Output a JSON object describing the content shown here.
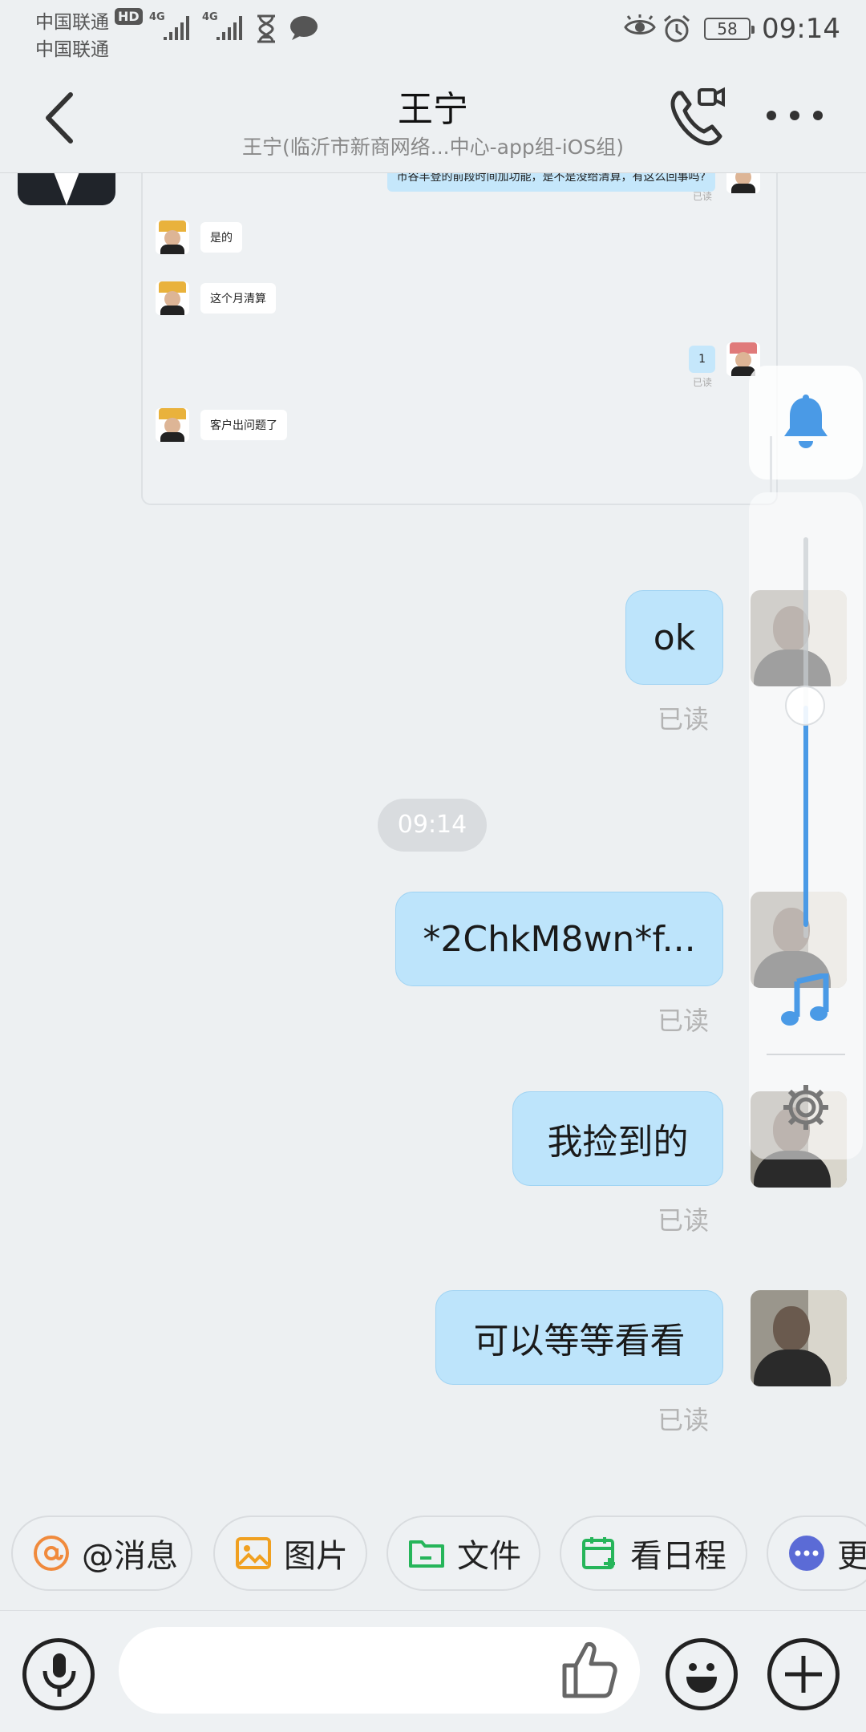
{
  "status_bar": {
    "carrier_1": "中国联通",
    "carrier_2": "中国联通",
    "hd_badge": "HD",
    "network_1": "4G",
    "network_2": "4G",
    "battery": "58",
    "time": "09:14"
  },
  "header": {
    "title": "王宁",
    "subtitle": "王宁(临沂市新商网络...中心-app组-iOS组)"
  },
  "embedded_screenshot": {
    "messages": [
      {
        "side": "right",
        "text": "币谷丰登的前段时间加功能，是不是没给清算，有这么回事吗?",
        "read": "已读"
      },
      {
        "side": "left",
        "text": "是的"
      },
      {
        "side": "left",
        "text": "这个月清算"
      },
      {
        "side": "right",
        "text": "1",
        "read": "已读"
      },
      {
        "side": "left",
        "text": "客户出问题了"
      }
    ]
  },
  "messages": [
    {
      "text": "ok",
      "read": "已读"
    },
    {
      "text": "*2ChkM8wn*f...",
      "read": "已读"
    },
    {
      "text": "我捡到的",
      "read": "已读"
    },
    {
      "text": "可以等等看看",
      "read": "已读"
    }
  ],
  "time_divider": "09:14",
  "quick_actions": [
    {
      "label": "@消息",
      "icon": "at-icon",
      "color": "#f08a3c"
    },
    {
      "label": "图片",
      "icon": "image-icon",
      "color": "#f0a020"
    },
    {
      "label": "文件",
      "icon": "folder-icon",
      "color": "#26b55a"
    },
    {
      "label": "看日程",
      "icon": "calendar-add-icon",
      "color": "#26b55a"
    },
    {
      "label": "更",
      "icon": "more-dots-icon",
      "color": "#5b6bd6"
    }
  ],
  "input": {
    "placeholder": ""
  },
  "side_panel": {
    "bell_icon": "bell-icon",
    "music_icon": "music-note-icon",
    "settings_icon": "gear-icon",
    "volume_level": 0.58,
    "accent_color": "#4a9ae6"
  }
}
